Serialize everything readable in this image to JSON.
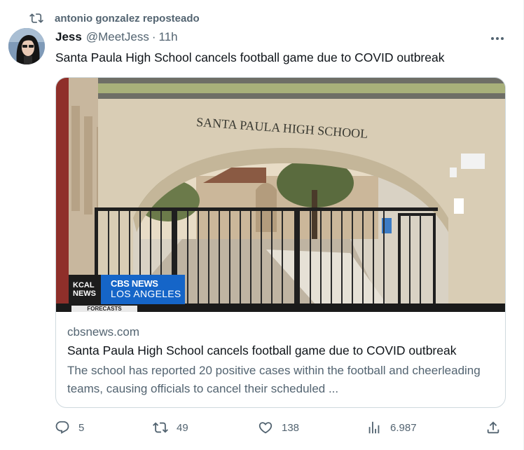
{
  "repost": {
    "label": "antonio gonzalez reposteado",
    "icon": "repost-icon"
  },
  "author": {
    "name": "Jess",
    "handle": "@MeetJess",
    "separator": "·",
    "time": "11h",
    "avatar": "avatar"
  },
  "tweet": {
    "text": "Santa Paula High School cancels football game due to COVID outbreak"
  },
  "card": {
    "image_sign": "SANTA PAULA HIGH SCHOOL",
    "broadcast": {
      "kcal_line1": "KCAL",
      "kcal_line2": "NEWS",
      "cbs": "CBS NEWS",
      "city": "LOS ANGELES",
      "ticker": "FORECASTS"
    },
    "domain": "cbsnews.com",
    "title": "Santa Paula High School cancels football game due to COVID outbreak",
    "description": "The school has reported 20 positive cases within the football and cheerleading teams, causing officials to cancel their scheduled ..."
  },
  "actions": {
    "replies": "5",
    "reposts": "49",
    "likes": "138",
    "views": "6.987"
  },
  "colors": {
    "secondary_text": "#536471",
    "primary_text": "#0f1419",
    "border": "#cfd9de",
    "cbs_blue": "#1565c8"
  }
}
